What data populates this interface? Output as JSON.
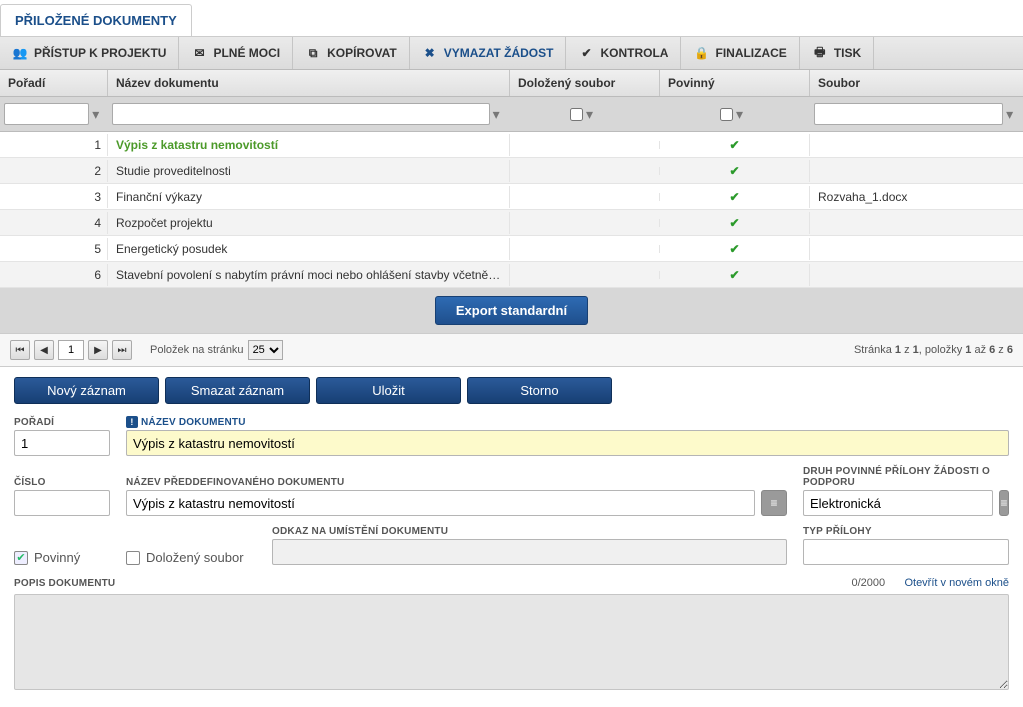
{
  "tab": {
    "title": "PŘILOŽENÉ DOKUMENTY"
  },
  "toolbar": {
    "access": "PŘÍSTUP K PROJEKTU",
    "power": "PLNÉ MOCI",
    "copy": "KOPÍROVAT",
    "delete": "VYMAZAT ŽÁDOST",
    "check": "KONTROLA",
    "finalize": "FINALIZACE",
    "print": "TISK"
  },
  "grid": {
    "headers": {
      "order": "Pořadí",
      "name": "Název dokumentu",
      "file": "Doložený soubor",
      "required": "Povinný",
      "soubor": "Soubor"
    },
    "rows": [
      {
        "order": "1",
        "name": "Výpis z katastru nemovitostí",
        "required": true,
        "soubor": "",
        "active": true
      },
      {
        "order": "2",
        "name": "Studie proveditelnosti",
        "required": true,
        "soubor": ""
      },
      {
        "order": "3",
        "name": "Finanční výkazy",
        "required": true,
        "soubor": "Rozvaha_1.docx"
      },
      {
        "order": "4",
        "name": "Rozpočet projektu",
        "required": true,
        "soubor": ""
      },
      {
        "order": "5",
        "name": "Energetický posudek",
        "required": true,
        "soubor": ""
      },
      {
        "order": "6",
        "name": "Stavební povolení s nabytím právní moci nebo ohlášení stavby včetně…",
        "required": true,
        "soubor": ""
      }
    ],
    "export": "Export standardní"
  },
  "pager": {
    "page": "1",
    "perPageLabel": "Položek na stránku",
    "perPage": "25",
    "summary_prefix": "Stránka ",
    "summary_page": "1",
    "summary_of": " z ",
    "summary_pages": "1",
    "summary_items": ", položky ",
    "summary_from": "1",
    "summary_to_word": " až ",
    "summary_to": "6",
    "summary_total_word": " z ",
    "summary_total": "6"
  },
  "actions": {
    "new": "Nový záznam",
    "delete": "Smazat záznam",
    "save": "Uložit",
    "cancel": "Storno"
  },
  "form": {
    "order_label": "POŘADÍ",
    "order_value": "1",
    "name_label": "NÁZEV DOKUMENTU",
    "name_value": "Výpis z katastru nemovitostí",
    "number_label": "ČÍSLO",
    "number_value": "",
    "predef_label": "NÁZEV PŘEDDEFINOVANÉHO DOKUMENTU",
    "predef_value": "Výpis z katastru nemovitostí",
    "kind_label": "DRUH POVINNÉ PŘÍLOHY ŽÁDOSTI O PODPORU",
    "kind_value": "Elektronická",
    "required_label": "Povinný",
    "file_label": "Doložený soubor",
    "link_label": "ODKAZ NA UMÍSTĚNÍ DOKUMENTU",
    "type_label": "TYP PŘÍLOHY",
    "desc_label": "POPIS DOKUMENTU",
    "counter": "0/2000",
    "open_new": "Otevřít v novém okně"
  }
}
